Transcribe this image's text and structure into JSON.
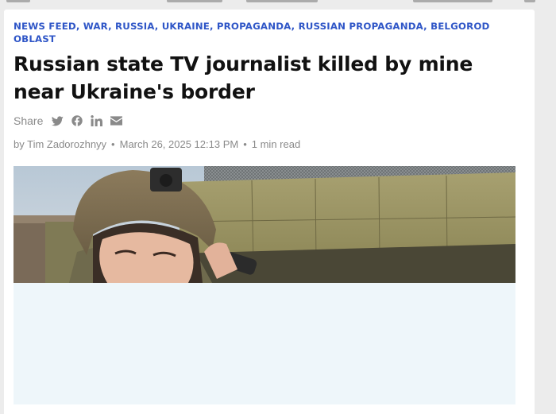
{
  "article": {
    "tags": [
      "News Feed",
      "War",
      "Russia",
      "Ukraine",
      "Propaganda",
      "Russian propaganda",
      "Belgorod Oblast"
    ],
    "title_line1": "Russian state TV journalist killed by mine",
    "title_line2": "near Ukraine's border",
    "share_label": "Share",
    "share_icons": [
      "twitter-icon",
      "facebook-icon",
      "linkedin-icon",
      "email-icon"
    ],
    "author": "by Tim Zadorozhnyy",
    "date": "March 26, 2025 12:13 PM",
    "read_time": "1 min read"
  },
  "colors": {
    "tag_blue": "#2f56c7",
    "meta_gray": "#8a8a8a",
    "title": "#111111",
    "placeholder_bg": "#eef6fa"
  }
}
